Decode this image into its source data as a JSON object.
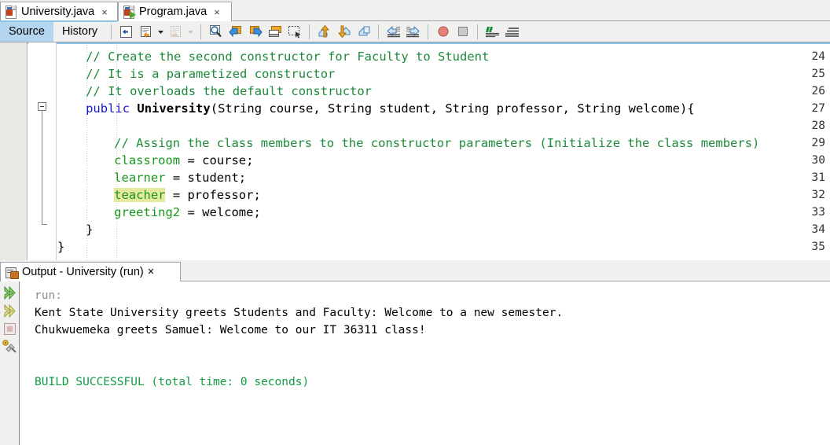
{
  "window": {
    "background_color": "#f0f0ef",
    "accent_color": "#b4d5f0"
  },
  "file_tabs": [
    {
      "label": "University.java",
      "icon": "java-file-icon",
      "close_label": "×",
      "active": true
    },
    {
      "label": "Program.java",
      "icon": "java-main-file-icon",
      "close_label": "×",
      "active": false
    }
  ],
  "view_tabs": [
    {
      "label": "Source",
      "selected": true
    },
    {
      "label": "History",
      "selected": false
    }
  ],
  "toolbar": {
    "buttons": [
      {
        "name": "last-edit-icon",
        "title": "Last Edit"
      },
      {
        "name": "back-history-icon",
        "title": "Back"
      },
      {
        "name": "back-history-dropdown-icon",
        "title": "Back dropdown"
      },
      {
        "name": "forward-history-icon",
        "title": "Forward"
      },
      {
        "name": "forward-history-dropdown-icon",
        "title": "Forward dropdown"
      },
      {
        "name": "find-selection-icon",
        "title": "Find Selection"
      },
      {
        "name": "find-previous-icon",
        "title": "Find Previous"
      },
      {
        "name": "find-next-icon",
        "title": "Find Next"
      },
      {
        "name": "toggle-highlight-icon",
        "title": "Toggle Highlight Search"
      },
      {
        "name": "toggle-rectangular-selection-icon",
        "title": "Rectangular Selection"
      },
      {
        "name": "previous-bookmark-icon",
        "title": "Previous Bookmark"
      },
      {
        "name": "next-bookmark-icon",
        "title": "Next Bookmark"
      },
      {
        "name": "toggle-bookmark-icon",
        "title": "Toggle Bookmark"
      },
      {
        "name": "shift-left-icon",
        "title": "Shift Left"
      },
      {
        "name": "shift-right-icon",
        "title": "Shift Right"
      },
      {
        "name": "start-macro-recording-icon",
        "title": "Start Macro Recording"
      },
      {
        "name": "stop-macro-recording-icon",
        "title": "Stop Macro Recording"
      },
      {
        "name": "comment-icon",
        "title": "Comment"
      },
      {
        "name": "uncomment-icon",
        "title": "Uncomment"
      }
    ]
  },
  "editor": {
    "first_visible_line": 23,
    "lines": [
      {
        "num": 24,
        "indent": 4,
        "tokens": [
          {
            "t": "// Create the second constructor for Faculty to Student",
            "c": "cmt"
          }
        ]
      },
      {
        "num": 25,
        "indent": 4,
        "tokens": [
          {
            "t": "// It is a parametized constructor",
            "c": "cmt"
          }
        ]
      },
      {
        "num": 26,
        "indent": 4,
        "tokens": [
          {
            "t": "// It overloads the default constructor",
            "c": "cmt"
          }
        ]
      },
      {
        "num": 27,
        "indent": 4,
        "tokens": [
          {
            "t": "public ",
            "c": "kw"
          },
          {
            "t": "University",
            "c": "bold"
          },
          {
            "t": "(String course, String student, String professor, String welcome){",
            "c": "pln"
          }
        ]
      },
      {
        "num": 28,
        "indent": 4,
        "tokens": []
      },
      {
        "num": 29,
        "indent": 8,
        "tokens": [
          {
            "t": "// Assign the class members to the constructor parameters (Initialize the class members)",
            "c": "cmt"
          }
        ]
      },
      {
        "num": 30,
        "indent": 8,
        "tokens": [
          {
            "t": "classroom",
            "c": "fld"
          },
          {
            "t": " = course;",
            "c": "pln"
          }
        ]
      },
      {
        "num": 31,
        "indent": 8,
        "tokens": [
          {
            "t": "learner",
            "c": "fld"
          },
          {
            "t": " = student;",
            "c": "pln"
          }
        ]
      },
      {
        "num": 32,
        "indent": 8,
        "tokens": [
          {
            "t": "teacher",
            "c": "hl"
          },
          {
            "t": " = professor;",
            "c": "pln"
          }
        ]
      },
      {
        "num": 33,
        "indent": 8,
        "tokens": [
          {
            "t": "greeting2",
            "c": "fld"
          },
          {
            "t": " = welcome;",
            "c": "pln"
          }
        ]
      },
      {
        "num": 34,
        "indent": 4,
        "tokens": [
          {
            "t": "}",
            "c": "pln"
          }
        ]
      },
      {
        "num": 35,
        "indent": 0,
        "tokens": [
          {
            "t": "}",
            "c": "pln"
          }
        ]
      }
    ],
    "fold_marker_line": 27,
    "colors": {
      "comment": "#1d8a3a",
      "keyword": "#1818cf",
      "field": "#15991b",
      "highlight_background": "#e8e9a0",
      "gutter_background": "#e9e8e2"
    }
  },
  "output": {
    "tab": {
      "label": "Output - University (run)",
      "icon": "output-window-icon",
      "close_label": "×"
    },
    "sidebar_buttons": [
      {
        "name": "rerun-icon",
        "title": "Re-run"
      },
      {
        "name": "rerun-with-different-params-icon",
        "title": "Re-run with different parameters"
      },
      {
        "name": "stop-process-icon",
        "title": "Stop process"
      },
      {
        "name": "configure-icon",
        "title": "Configure"
      }
    ],
    "lines": [
      {
        "text": "run:",
        "color": "gray"
      },
      {
        "text": "Kent State University greets Students and Faculty: Welcome to a new semester.",
        "color": "black"
      },
      {
        "text": "Chukwuemeka greets Samuel: Welcome to our IT 36311 class!",
        "color": "black"
      },
      {
        "text": "",
        "color": "black"
      },
      {
        "text": "",
        "color": "black"
      },
      {
        "text": "BUILD SUCCESSFUL (total time: 0 seconds)",
        "color": "green"
      }
    ],
    "colors": {
      "gray": "#8d8d8d",
      "green": "#0f9c45",
      "black": "#000000"
    }
  }
}
